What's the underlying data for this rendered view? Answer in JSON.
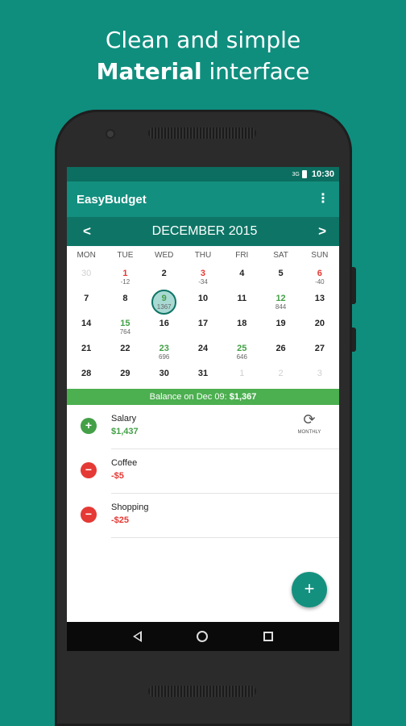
{
  "headline": {
    "line1": "Clean and simple",
    "line2_bold": "Material",
    "line2_rest": " interface"
  },
  "status": {
    "signal": "3G",
    "time": "10:30"
  },
  "app": {
    "title": "EasyBudget",
    "menu_icon": "more-vert-icon"
  },
  "calendar": {
    "prev": "<",
    "next": ">",
    "month": "DECEMBER 2015",
    "weekdays": [
      "MON",
      "TUE",
      "WED",
      "THU",
      "FRI",
      "SAT",
      "SUN"
    ],
    "days": [
      {
        "d": "30",
        "s": "",
        "t": "other"
      },
      {
        "d": "1",
        "s": "-12",
        "t": "neg"
      },
      {
        "d": "2",
        "s": "",
        "t": ""
      },
      {
        "d": "3",
        "s": "-34",
        "t": "neg"
      },
      {
        "d": "4",
        "s": "",
        "t": ""
      },
      {
        "d": "5",
        "s": "",
        "t": ""
      },
      {
        "d": "6",
        "s": "-40",
        "t": "neg"
      },
      {
        "d": "7",
        "s": "",
        "t": ""
      },
      {
        "d": "8",
        "s": "",
        "t": ""
      },
      {
        "d": "9",
        "s": "1367",
        "t": "sel"
      },
      {
        "d": "10",
        "s": "",
        "t": ""
      },
      {
        "d": "11",
        "s": "",
        "t": ""
      },
      {
        "d": "12",
        "s": "844",
        "t": "pos"
      },
      {
        "d": "13",
        "s": "",
        "t": ""
      },
      {
        "d": "14",
        "s": "",
        "t": ""
      },
      {
        "d": "15",
        "s": "764",
        "t": "pos"
      },
      {
        "d": "16",
        "s": "",
        "t": ""
      },
      {
        "d": "17",
        "s": "",
        "t": ""
      },
      {
        "d": "18",
        "s": "",
        "t": ""
      },
      {
        "d": "19",
        "s": "",
        "t": ""
      },
      {
        "d": "20",
        "s": "",
        "t": ""
      },
      {
        "d": "21",
        "s": "",
        "t": ""
      },
      {
        "d": "22",
        "s": "",
        "t": ""
      },
      {
        "d": "23",
        "s": "696",
        "t": "pos"
      },
      {
        "d": "24",
        "s": "",
        "t": ""
      },
      {
        "d": "25",
        "s": "646",
        "t": "pos"
      },
      {
        "d": "26",
        "s": "",
        "t": ""
      },
      {
        "d": "27",
        "s": "",
        "t": ""
      },
      {
        "d": "28",
        "s": "",
        "t": ""
      },
      {
        "d": "29",
        "s": "",
        "t": ""
      },
      {
        "d": "30",
        "s": "",
        "t": ""
      },
      {
        "d": "31",
        "s": "",
        "t": ""
      },
      {
        "d": "1",
        "s": "",
        "t": "other"
      },
      {
        "d": "2",
        "s": "",
        "t": "other"
      },
      {
        "d": "3",
        "s": "",
        "t": "other"
      }
    ]
  },
  "balance": {
    "label": "Balance on Dec 09: ",
    "amount": "$1,367"
  },
  "entries": [
    {
      "name": "Salary",
      "amount": "$1,437",
      "kind": "plus",
      "recurring": "MONTHLY",
      "recur_icon": "sync-icon"
    },
    {
      "name": "Coffee",
      "amount": "-$5",
      "kind": "minus"
    },
    {
      "name": "Shopping",
      "amount": "-$25",
      "kind": "minus"
    }
  ],
  "fab": {
    "label": "+"
  },
  "colors": {
    "background": "#0f8e7e",
    "primary": "#138f7f",
    "primary_dark": "#0e7566",
    "positive": "#43a047",
    "negative": "#e53935"
  }
}
